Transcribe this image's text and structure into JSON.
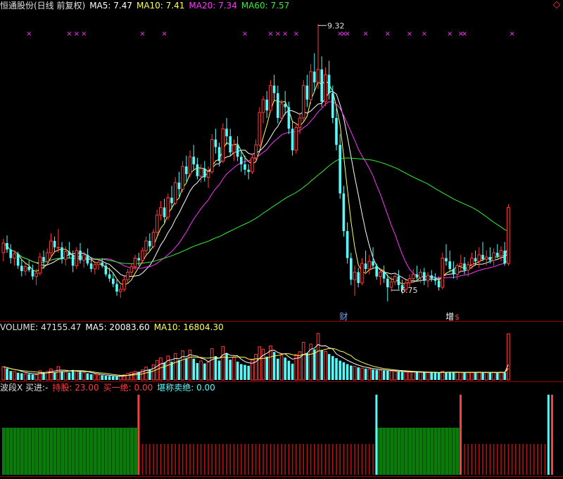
{
  "header": {
    "title": "恒通股份(日线 前复权)",
    "ma5_label": "MA5: 7.47",
    "ma10_label": "MA10: 7.41",
    "ma20_label": "MA20: 7.34",
    "ma60_label": "MA60: 7.57"
  },
  "volume_header": {
    "label": "VOLUME: 47155.47",
    "ma5_label": "MA5: 20083.60",
    "ma10_label": "MA10: 16804.30"
  },
  "indicator_header": {
    "name": "波段X 买进:-",
    "hold_label": "持股: 23.00",
    "buy_label": "买一绝: 0.00",
    "sell_label": "堪称卖绝: 0.00"
  },
  "colors": {
    "up": "#ff3b3b",
    "down": "#54fcfc",
    "ma5": "#ffff55",
    "ma10": "#ffffff",
    "ma20": "#ff33ff",
    "ma60": "#33ee33",
    "marker": "#ff33ff",
    "hold_bar": "#0a7a0a",
    "panel_divider": "#a00000"
  },
  "chart_data": [
    {
      "type": "candlestick",
      "title": "恒通股份(日线 前复权)",
      "ylim": [
        6.6,
        9.4
      ],
      "annotations": [
        {
          "text": "9.32",
          "kind": "high",
          "index": 86
        },
        {
          "text": "6.75",
          "kind": "low",
          "index": 106
        },
        {
          "text": "财",
          "kind": "event-badge",
          "index": 93
        },
        {
          "text": "增",
          "kind": "event-badge",
          "index": 122
        },
        {
          "text": "$",
          "kind": "event-badge",
          "index": 124
        }
      ],
      "marker_indices": [
        7,
        18,
        20,
        22,
        38,
        44,
        66,
        73,
        75,
        77,
        80,
        92,
        93,
        94,
        99,
        105,
        111,
        115,
        122,
        125,
        126,
        139
      ],
      "marker_symbol": "×",
      "series": [
        {
          "name": "MA5",
          "source": "MA5: 7.47"
        },
        {
          "name": "MA10",
          "source": "MA10: 7.41"
        },
        {
          "name": "MA20",
          "source": "MA20: 7.34"
        },
        {
          "name": "MA60",
          "source": "MA60: 7.57"
        }
      ],
      "ohlc": [
        [
          7.2,
          7.33,
          7.12,
          7.29
        ],
        [
          7.29,
          7.36,
          7.2,
          7.23
        ],
        [
          7.23,
          7.28,
          7.1,
          7.15
        ],
        [
          7.15,
          7.22,
          7.08,
          7.19
        ],
        [
          7.19,
          7.21,
          7.05,
          7.08
        ],
        [
          7.08,
          7.14,
          6.98,
          7.03
        ],
        [
          7.03,
          7.1,
          6.99,
          7.07
        ],
        [
          7.07,
          7.13,
          7.02,
          7.04
        ],
        [
          7.04,
          7.09,
          6.95,
          6.98
        ],
        [
          6.98,
          7.05,
          6.9,
          7.01
        ],
        [
          7.01,
          7.2,
          6.99,
          7.16
        ],
        [
          7.16,
          7.22,
          7.05,
          7.12
        ],
        [
          7.12,
          7.24,
          7.09,
          7.2
        ],
        [
          7.2,
          7.38,
          7.15,
          7.31
        ],
        [
          7.31,
          7.35,
          7.21,
          7.25
        ],
        [
          7.25,
          7.42,
          7.2,
          7.25
        ],
        [
          7.25,
          7.3,
          7.1,
          7.14
        ],
        [
          7.14,
          7.26,
          7.08,
          7.21
        ],
        [
          7.21,
          7.3,
          7.15,
          7.18
        ],
        [
          7.18,
          7.22,
          7.02,
          7.08
        ],
        [
          7.08,
          7.25,
          7.05,
          7.22
        ],
        [
          7.22,
          7.29,
          7.1,
          7.13
        ],
        [
          7.13,
          7.21,
          7.06,
          7.18
        ],
        [
          7.18,
          7.24,
          7.08,
          7.1
        ],
        [
          7.1,
          7.15,
          7.02,
          7.05
        ],
        [
          7.05,
          7.12,
          7.0,
          7.09
        ],
        [
          7.09,
          7.14,
          7.04,
          7.11
        ],
        [
          7.11,
          7.15,
          7.06,
          7.08
        ],
        [
          7.08,
          7.1,
          6.98,
          7.0
        ],
        [
          7.0,
          7.06,
          6.93,
          6.96
        ],
        [
          6.96,
          7.02,
          6.88,
          6.91
        ],
        [
          6.91,
          6.95,
          6.8,
          6.84
        ],
        [
          6.84,
          6.9,
          6.78,
          6.86
        ],
        [
          6.86,
          6.98,
          6.84,
          6.95
        ],
        [
          6.95,
          7.05,
          6.92,
          7.02
        ],
        [
          7.02,
          7.1,
          6.98,
          7.07
        ],
        [
          7.07,
          7.18,
          7.04,
          7.15
        ],
        [
          7.15,
          7.2,
          7.08,
          7.13
        ],
        [
          7.13,
          7.25,
          7.1,
          7.22
        ],
        [
          7.22,
          7.35,
          7.18,
          7.31
        ],
        [
          7.31,
          7.38,
          7.22,
          7.26
        ],
        [
          7.26,
          7.42,
          7.24,
          7.39
        ],
        [
          7.39,
          7.6,
          7.35,
          7.55
        ],
        [
          7.55,
          7.68,
          7.5,
          7.62
        ],
        [
          7.62,
          7.7,
          7.48,
          7.53
        ],
        [
          7.53,
          7.75,
          7.5,
          7.71
        ],
        [
          7.71,
          7.82,
          7.6,
          7.66
        ],
        [
          7.66,
          7.9,
          7.64,
          7.85
        ],
        [
          7.85,
          7.95,
          7.72,
          7.79
        ],
        [
          7.79,
          8.05,
          7.76,
          8.0
        ],
        [
          8.0,
          8.1,
          7.86,
          7.93
        ],
        [
          7.93,
          8.15,
          7.9,
          8.09
        ],
        [
          8.09,
          8.2,
          7.96,
          8.02
        ],
        [
          8.02,
          8.08,
          7.88,
          7.91
        ],
        [
          7.91,
          8.02,
          7.85,
          7.98
        ],
        [
          7.98,
          8.05,
          7.86,
          7.9
        ],
        [
          7.9,
          8.0,
          7.8,
          7.95
        ],
        [
          7.95,
          8.3,
          7.93,
          8.25
        ],
        [
          8.25,
          8.35,
          8.12,
          8.18
        ],
        [
          8.18,
          8.22,
          8.0,
          8.05
        ],
        [
          8.05,
          8.4,
          8.03,
          8.35
        ],
        [
          8.35,
          8.45,
          8.2,
          8.28
        ],
        [
          8.28,
          8.35,
          8.1,
          8.13
        ],
        [
          8.13,
          8.25,
          8.05,
          8.2
        ],
        [
          8.2,
          8.28,
          8.05,
          8.09
        ],
        [
          8.09,
          8.15,
          7.95,
          8.02
        ],
        [
          8.02,
          8.1,
          7.92,
          7.97
        ],
        [
          7.97,
          8.02,
          7.88,
          7.95
        ],
        [
          7.95,
          8.12,
          7.93,
          8.08
        ],
        [
          8.08,
          8.25,
          8.05,
          8.2
        ],
        [
          8.2,
          8.55,
          8.18,
          8.5
        ],
        [
          8.5,
          8.65,
          8.4,
          8.62
        ],
        [
          8.62,
          8.7,
          8.45,
          8.52
        ],
        [
          8.52,
          8.8,
          8.5,
          8.75
        ],
        [
          8.75,
          8.85,
          8.6,
          8.68
        ],
        [
          8.68,
          8.75,
          8.4,
          8.45
        ],
        [
          8.45,
          8.62,
          8.42,
          8.58
        ],
        [
          8.58,
          8.7,
          8.48,
          8.55
        ],
        [
          8.55,
          8.6,
          8.3,
          8.35
        ],
        [
          8.35,
          8.42,
          8.1,
          8.15
        ],
        [
          8.15,
          8.4,
          8.12,
          8.36
        ],
        [
          8.36,
          8.5,
          8.3,
          8.45
        ],
        [
          8.45,
          8.8,
          8.42,
          8.75
        ],
        [
          8.75,
          8.85,
          8.55,
          8.62
        ],
        [
          8.62,
          8.95,
          8.58,
          8.88
        ],
        [
          8.88,
          9.05,
          8.7,
          8.78
        ],
        [
          8.78,
          9.32,
          8.72,
          8.9
        ],
        [
          8.9,
          9.02,
          8.55,
          8.6
        ],
        [
          8.6,
          8.92,
          8.56,
          8.85
        ],
        [
          8.85,
          8.98,
          8.62,
          8.68
        ],
        [
          8.68,
          8.75,
          8.4,
          8.45
        ],
        [
          8.45,
          8.55,
          8.15,
          8.2
        ],
        [
          8.2,
          8.3,
          7.7,
          7.75
        ],
        [
          7.75,
          7.82,
          7.35,
          7.4
        ],
        [
          7.4,
          7.48,
          7.1,
          7.15
        ],
        [
          7.15,
          7.2,
          6.9,
          6.95
        ],
        [
          6.95,
          7.08,
          6.8,
          7.02
        ],
        [
          7.02,
          7.06,
          6.88,
          6.92
        ],
        [
          6.92,
          7.15,
          6.9,
          7.1
        ],
        [
          7.1,
          7.22,
          7.02,
          7.05
        ],
        [
          7.05,
          7.18,
          7.0,
          7.12
        ],
        [
          7.12,
          7.25,
          7.05,
          7.08
        ],
        [
          7.08,
          7.1,
          6.95,
          6.98
        ],
        [
          6.98,
          7.05,
          6.9,
          7.02
        ],
        [
          7.02,
          7.08,
          6.92,
          6.96
        ],
        [
          6.96,
          7.0,
          6.75,
          6.88
        ],
        [
          6.88,
          6.98,
          6.84,
          6.93
        ],
        [
          6.93,
          7.02,
          6.9,
          6.98
        ],
        [
          6.98,
          7.04,
          6.86,
          6.9
        ],
        [
          6.9,
          6.95,
          6.82,
          6.86
        ],
        [
          6.86,
          6.95,
          6.84,
          6.92
        ],
        [
          6.92,
          7.0,
          6.88,
          6.96
        ],
        [
          6.96,
          7.05,
          6.92,
          7.0
        ],
        [
          7.0,
          7.08,
          6.95,
          6.97
        ],
        [
          6.97,
          7.05,
          6.92,
          7.02
        ],
        [
          7.02,
          7.06,
          6.9,
          6.94
        ],
        [
          6.94,
          7.02,
          6.88,
          6.99
        ],
        [
          6.99,
          7.04,
          6.93,
          6.96
        ],
        [
          6.96,
          7.01,
          6.9,
          6.94
        ],
        [
          6.94,
          6.98,
          6.85,
          6.88
        ],
        [
          6.88,
          7.2,
          6.86,
          7.15
        ],
        [
          7.15,
          7.28,
          7.08,
          7.12
        ],
        [
          7.12,
          7.22,
          7.02,
          7.05
        ],
        [
          7.05,
          7.12,
          6.96,
          7.0
        ],
        [
          7.0,
          7.1,
          6.95,
          7.08
        ],
        [
          7.08,
          7.18,
          7.02,
          7.1
        ],
        [
          7.1,
          7.16,
          7.0,
          7.04
        ],
        [
          7.04,
          7.12,
          6.98,
          7.09
        ],
        [
          7.09,
          7.2,
          7.05,
          7.15
        ],
        [
          7.15,
          7.22,
          7.08,
          7.12
        ],
        [
          7.12,
          7.25,
          7.06,
          7.18
        ],
        [
          7.18,
          7.3,
          7.12,
          7.14
        ],
        [
          7.14,
          7.22,
          7.08,
          7.16
        ],
        [
          7.16,
          7.25,
          7.1,
          7.13
        ],
        [
          7.13,
          7.24,
          7.08,
          7.2
        ],
        [
          7.2,
          7.28,
          7.15,
          7.17
        ],
        [
          7.17,
          7.26,
          7.12,
          7.22
        ],
        [
          7.22,
          7.3,
          7.08,
          7.1
        ],
        [
          7.1,
          7.65,
          7.08,
          7.62
        ]
      ]
    },
    {
      "type": "bar",
      "title": "VOLUME: 47155.47",
      "ylim": [
        0,
        48000
      ],
      "series": [
        {
          "name": "VOLUME",
          "values": [
            13500,
            11800,
            9200,
            8600,
            7400,
            6900,
            6200,
            6000,
            5600,
            5300,
            9400,
            8100,
            8800,
            11300,
            7600,
            13600,
            9000,
            8400,
            7600,
            10200,
            9500,
            8300,
            7400,
            6800,
            5900,
            5600,
            5000,
            4700,
            4300,
            4000,
            3800,
            3600,
            4100,
            5200,
            6800,
            7900,
            8800,
            8400,
            10300,
            13200,
            11000,
            15400,
            19800,
            22500,
            17600,
            24400,
            18600,
            27000,
            20300,
            29700,
            22100,
            30500,
            21800,
            17200,
            19400,
            16800,
            18100,
            31900,
            24300,
            19800,
            34200,
            26800,
            20700,
            23100,
            18700,
            16200,
            15300,
            14500,
            20400,
            26200,
            33800,
            31400,
            23800,
            34700,
            28500,
            21700,
            25300,
            22800,
            19600,
            16600,
            25900,
            28800,
            38300,
            27300,
            36600,
            31200,
            47400,
            30400,
            29100,
            26400,
            24400,
            22300,
            19700,
            18100,
            16200,
            14700,
            13900,
            12800,
            12100,
            11600,
            11200,
            10700,
            10300,
            9900,
            9600,
            9400,
            9100,
            8800,
            8600,
            8400,
            8200,
            8100,
            8000,
            7900,
            7800,
            7700,
            7600,
            7500,
            7400,
            7300,
            8900,
            8200,
            7900,
            7600,
            7800,
            7700,
            7500,
            7600,
            7900,
            7800,
            8100,
            7700,
            7600,
            7500,
            7900,
            7800,
            8000,
            7600,
            47155
          ]
        },
        {
          "name": "MA5",
          "source": "MA5: 20083.60"
        },
        {
          "name": "MA10",
          "source": "MA10: 16804.30"
        }
      ]
    },
    {
      "type": "bar",
      "title": "波段X 买进:-",
      "segments": [
        {
          "state": "hold",
          "start": 0,
          "end": 36
        },
        {
          "state": "wait",
          "start": 37,
          "end": 101
        },
        {
          "state": "hold",
          "start": 102,
          "end": 124
        },
        {
          "state": "wait",
          "start": 125,
          "end": 148
        }
      ],
      "signals": [
        {
          "kind": "sell",
          "index": 37
        },
        {
          "kind": "buy",
          "index": 102
        },
        {
          "kind": "sell",
          "index": 125
        },
        {
          "kind": "buy",
          "index": 149
        },
        {
          "kind": "sell",
          "index": 150
        }
      ]
    }
  ]
}
